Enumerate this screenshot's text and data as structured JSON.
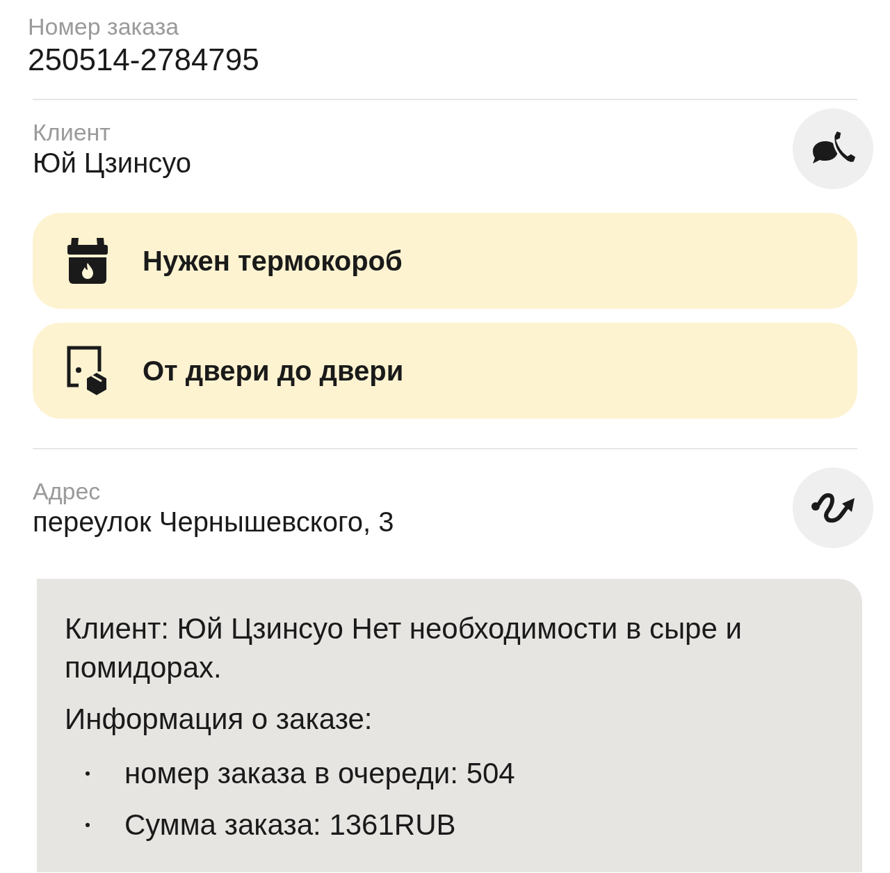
{
  "order": {
    "label": "Номер заказа",
    "value": "250514-2784795"
  },
  "client": {
    "label": "Клиент",
    "value": "Юй Цзинсуо"
  },
  "tags": [
    {
      "kind": "thermobox",
      "label": "Нужен термокороб"
    },
    {
      "kind": "door",
      "label": "От двери до двери"
    }
  ],
  "address": {
    "label": "Адрес",
    "value": "переулок Чернышевского, 3"
  },
  "comment": {
    "paragraphs": [
      "Клиент: Юй Цзинсуо Нет необходимости в сыре и помидорах.",
      "Информация о заказе:"
    ],
    "items": [
      "номер заказа в очереди: 504",
      "Сумма заказа: 1361RUB"
    ]
  }
}
